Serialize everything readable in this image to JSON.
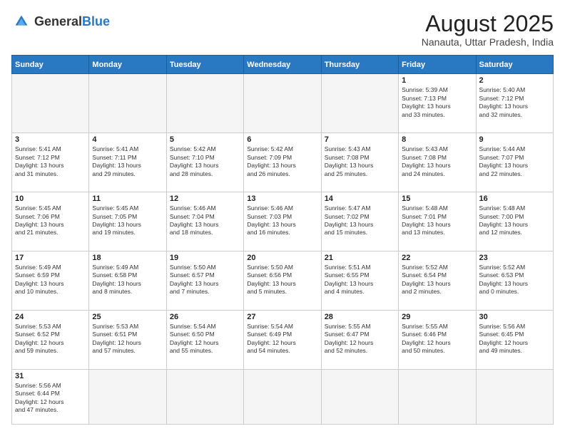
{
  "header": {
    "logo_general": "General",
    "logo_blue": "Blue",
    "title": "August 2025",
    "subtitle": "Nanauta, Uttar Pradesh, India"
  },
  "weekdays": [
    "Sunday",
    "Monday",
    "Tuesday",
    "Wednesday",
    "Thursday",
    "Friday",
    "Saturday"
  ],
  "weeks": [
    [
      {
        "day": "",
        "info": ""
      },
      {
        "day": "",
        "info": ""
      },
      {
        "day": "",
        "info": ""
      },
      {
        "day": "",
        "info": ""
      },
      {
        "day": "",
        "info": ""
      },
      {
        "day": "1",
        "info": "Sunrise: 5:39 AM\nSunset: 7:13 PM\nDaylight: 13 hours\nand 33 minutes."
      },
      {
        "day": "2",
        "info": "Sunrise: 5:40 AM\nSunset: 7:12 PM\nDaylight: 13 hours\nand 32 minutes."
      }
    ],
    [
      {
        "day": "3",
        "info": "Sunrise: 5:41 AM\nSunset: 7:12 PM\nDaylight: 13 hours\nand 31 minutes."
      },
      {
        "day": "4",
        "info": "Sunrise: 5:41 AM\nSunset: 7:11 PM\nDaylight: 13 hours\nand 29 minutes."
      },
      {
        "day": "5",
        "info": "Sunrise: 5:42 AM\nSunset: 7:10 PM\nDaylight: 13 hours\nand 28 minutes."
      },
      {
        "day": "6",
        "info": "Sunrise: 5:42 AM\nSunset: 7:09 PM\nDaylight: 13 hours\nand 26 minutes."
      },
      {
        "day": "7",
        "info": "Sunrise: 5:43 AM\nSunset: 7:08 PM\nDaylight: 13 hours\nand 25 minutes."
      },
      {
        "day": "8",
        "info": "Sunrise: 5:43 AM\nSunset: 7:08 PM\nDaylight: 13 hours\nand 24 minutes."
      },
      {
        "day": "9",
        "info": "Sunrise: 5:44 AM\nSunset: 7:07 PM\nDaylight: 13 hours\nand 22 minutes."
      }
    ],
    [
      {
        "day": "10",
        "info": "Sunrise: 5:45 AM\nSunset: 7:06 PM\nDaylight: 13 hours\nand 21 minutes."
      },
      {
        "day": "11",
        "info": "Sunrise: 5:45 AM\nSunset: 7:05 PM\nDaylight: 13 hours\nand 19 minutes."
      },
      {
        "day": "12",
        "info": "Sunrise: 5:46 AM\nSunset: 7:04 PM\nDaylight: 13 hours\nand 18 minutes."
      },
      {
        "day": "13",
        "info": "Sunrise: 5:46 AM\nSunset: 7:03 PM\nDaylight: 13 hours\nand 16 minutes."
      },
      {
        "day": "14",
        "info": "Sunrise: 5:47 AM\nSunset: 7:02 PM\nDaylight: 13 hours\nand 15 minutes."
      },
      {
        "day": "15",
        "info": "Sunrise: 5:48 AM\nSunset: 7:01 PM\nDaylight: 13 hours\nand 13 minutes."
      },
      {
        "day": "16",
        "info": "Sunrise: 5:48 AM\nSunset: 7:00 PM\nDaylight: 13 hours\nand 12 minutes."
      }
    ],
    [
      {
        "day": "17",
        "info": "Sunrise: 5:49 AM\nSunset: 6:59 PM\nDaylight: 13 hours\nand 10 minutes."
      },
      {
        "day": "18",
        "info": "Sunrise: 5:49 AM\nSunset: 6:58 PM\nDaylight: 13 hours\nand 8 minutes."
      },
      {
        "day": "19",
        "info": "Sunrise: 5:50 AM\nSunset: 6:57 PM\nDaylight: 13 hours\nand 7 minutes."
      },
      {
        "day": "20",
        "info": "Sunrise: 5:50 AM\nSunset: 6:56 PM\nDaylight: 13 hours\nand 5 minutes."
      },
      {
        "day": "21",
        "info": "Sunrise: 5:51 AM\nSunset: 6:55 PM\nDaylight: 13 hours\nand 4 minutes."
      },
      {
        "day": "22",
        "info": "Sunrise: 5:52 AM\nSunset: 6:54 PM\nDaylight: 13 hours\nand 2 minutes."
      },
      {
        "day": "23",
        "info": "Sunrise: 5:52 AM\nSunset: 6:53 PM\nDaylight: 13 hours\nand 0 minutes."
      }
    ],
    [
      {
        "day": "24",
        "info": "Sunrise: 5:53 AM\nSunset: 6:52 PM\nDaylight: 12 hours\nand 59 minutes."
      },
      {
        "day": "25",
        "info": "Sunrise: 5:53 AM\nSunset: 6:51 PM\nDaylight: 12 hours\nand 57 minutes."
      },
      {
        "day": "26",
        "info": "Sunrise: 5:54 AM\nSunset: 6:50 PM\nDaylight: 12 hours\nand 55 minutes."
      },
      {
        "day": "27",
        "info": "Sunrise: 5:54 AM\nSunset: 6:49 PM\nDaylight: 12 hours\nand 54 minutes."
      },
      {
        "day": "28",
        "info": "Sunrise: 5:55 AM\nSunset: 6:47 PM\nDaylight: 12 hours\nand 52 minutes."
      },
      {
        "day": "29",
        "info": "Sunrise: 5:55 AM\nSunset: 6:46 PM\nDaylight: 12 hours\nand 50 minutes."
      },
      {
        "day": "30",
        "info": "Sunrise: 5:56 AM\nSunset: 6:45 PM\nDaylight: 12 hours\nand 49 minutes."
      }
    ],
    [
      {
        "day": "31",
        "info": "Sunrise: 5:56 AM\nSunset: 6:44 PM\nDaylight: 12 hours\nand 47 minutes."
      },
      {
        "day": "",
        "info": ""
      },
      {
        "day": "",
        "info": ""
      },
      {
        "day": "",
        "info": ""
      },
      {
        "day": "",
        "info": ""
      },
      {
        "day": "",
        "info": ""
      },
      {
        "day": "",
        "info": ""
      }
    ]
  ]
}
